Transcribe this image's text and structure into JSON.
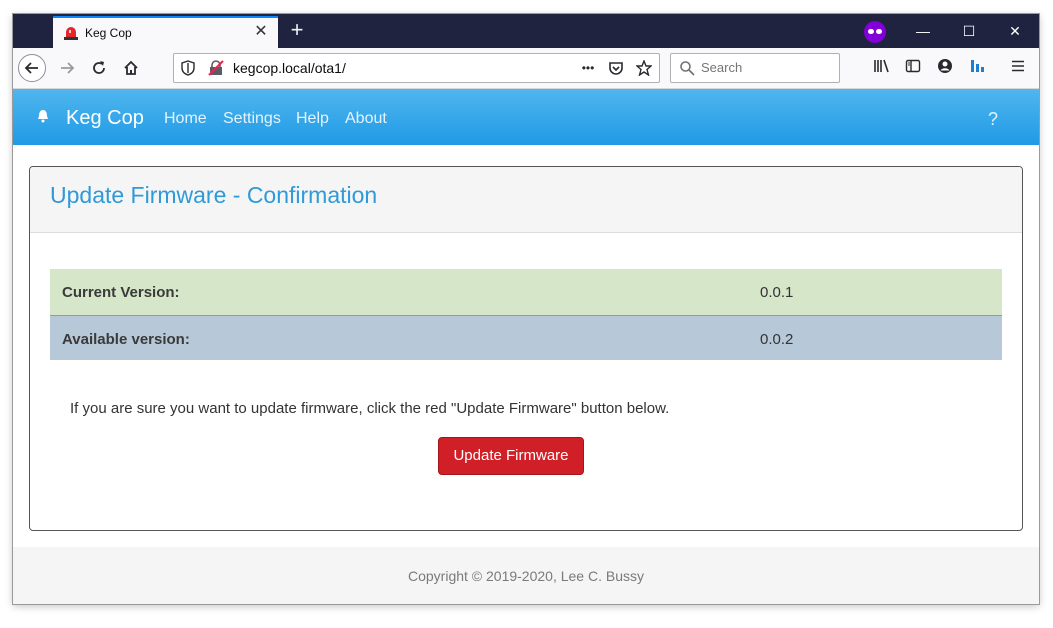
{
  "browser": {
    "tab": {
      "title": "Keg Cop",
      "favicon": "siren-icon",
      "close_glyph": "✕"
    },
    "new_tab_glyph": "+",
    "window_controls": {
      "minimize": "—",
      "maximize": "☐",
      "close": "✕"
    },
    "url": "kegcop.local/ota1/",
    "search_placeholder": "Search",
    "page_actions_glyph": "•••",
    "colors": {
      "tab_accent": "#0a84ff",
      "private_badge": "#8000d7",
      "tabstrip": "#202340"
    }
  },
  "app": {
    "brand": "Keg Cop",
    "nav": [
      {
        "label": "Home"
      },
      {
        "label": "Settings"
      },
      {
        "label": "Help"
      },
      {
        "label": "About"
      }
    ],
    "help_label": "?",
    "colors": {
      "appbar": "#1f9ae6",
      "title": "#2e9ad8",
      "button": "#d01f26"
    }
  },
  "card": {
    "title": "Update Firmware - Confirmation",
    "rows": [
      {
        "label": "Current Version:",
        "value": "0.0.1"
      },
      {
        "label": "Available version:",
        "value": "0.0.2"
      }
    ],
    "instruction": "If you are sure you want to update firmware, click the red \"Update Firmware\" button below.",
    "button_label": "Update Firmware"
  },
  "footer": {
    "copyright": "Copyright © 2019-2020, Lee C. Bussy"
  }
}
